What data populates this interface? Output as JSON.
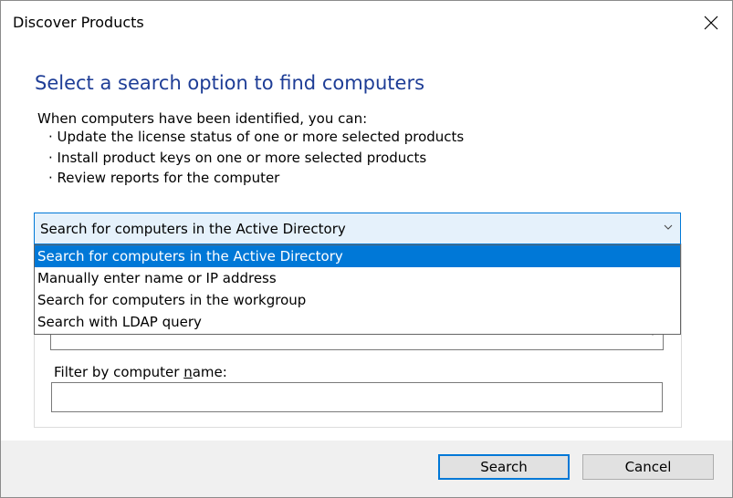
{
  "window": {
    "title": "Discover Products"
  },
  "heading": "Select a search option to find computers",
  "intro": "When computers have been identified, you can:",
  "bullets": [
    "Update the license status of one or more selected products",
    "Install product keys on one or more selected products",
    "Review reports for the computer"
  ],
  "search_option": {
    "selected": "Search for computers in the Active Directory",
    "options": [
      "Search for computers in the Active Directory",
      "Manually enter name or IP address",
      "Search for computers in the workgroup",
      "Search with LDAP query"
    ]
  },
  "filter": {
    "label_prefix": "Filter by computer ",
    "label_accel": "n",
    "label_suffix": "ame:",
    "value": ""
  },
  "buttons": {
    "search": "Search",
    "cancel": "Cancel"
  },
  "colors": {
    "accent": "#0078d7",
    "heading": "#1e3d96"
  }
}
